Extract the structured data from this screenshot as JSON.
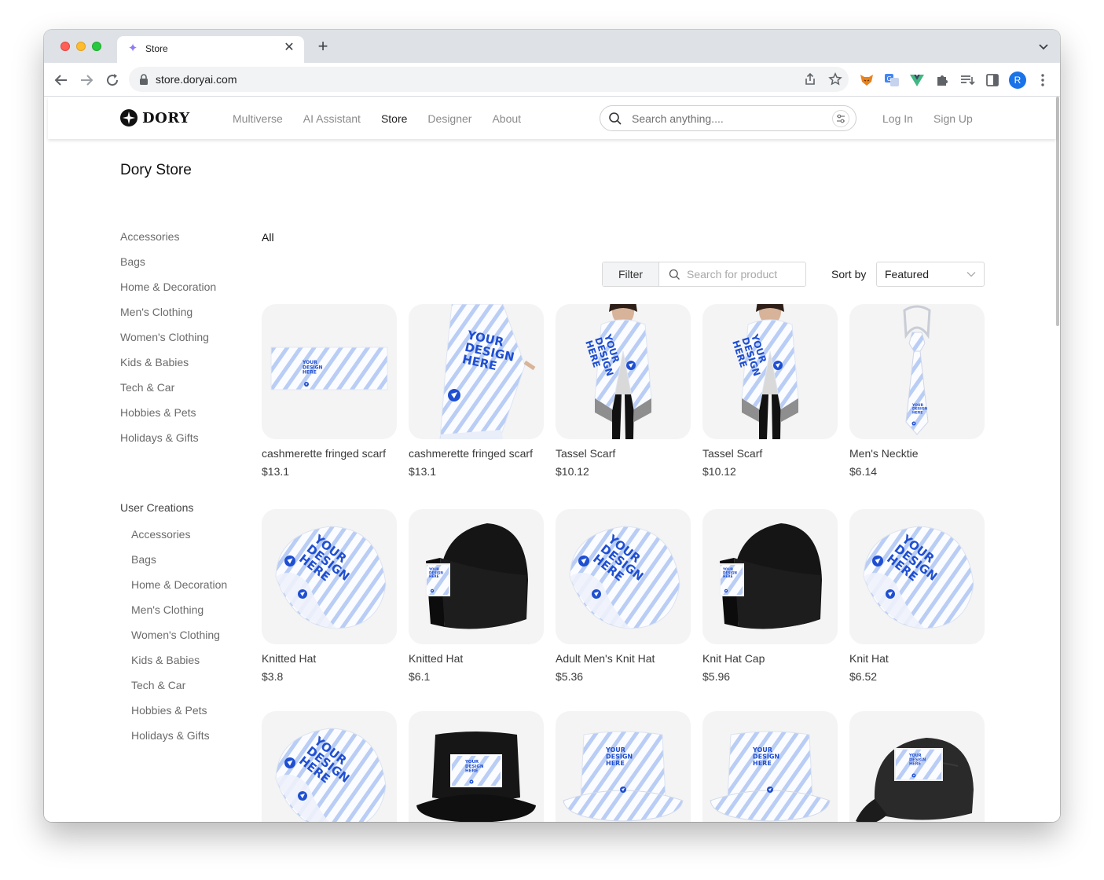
{
  "browser": {
    "tab_title": "Store",
    "url": "store.doryai.com",
    "profile_initial": "R"
  },
  "site": {
    "brand": "DORY",
    "nav": [
      "Multiverse",
      "AI Assistant",
      "Store",
      "Designer",
      "About"
    ],
    "nav_active": "Store",
    "search_placeholder": "Search anything....",
    "login_label": "Log In",
    "signup_label": "Sign Up"
  },
  "store": {
    "title": "Dory Store",
    "categories": [
      "Accessories",
      "Bags",
      "Home & Decoration",
      "Men's Clothing",
      "Women's Clothing",
      "Kids & Babies",
      "Tech & Car",
      "Hobbies & Pets",
      "Holidays & Gifts"
    ],
    "user_creations_label": "User Creations",
    "user_creations": [
      "Accessories",
      "Bags",
      "Home & Decoration",
      "Men's Clothing",
      "Women's Clothing",
      "Kids & Babies",
      "Tech & Car",
      "Hobbies & Pets",
      "Holidays & Gifts"
    ],
    "all_label": "All",
    "filter_label": "Filter",
    "product_search_placeholder": "Search for product",
    "sort_label": "Sort by",
    "sort_value": "Featured"
  },
  "products": [
    {
      "name": "cashmerette fringed scarf",
      "price": "$13.1",
      "kind": "scarf-flat"
    },
    {
      "name": "cashmerette fringed scarf",
      "price": "$13.1",
      "kind": "scarf-worn"
    },
    {
      "name": "Tassel Scarf",
      "price": "$10.12",
      "kind": "scarf-person"
    },
    {
      "name": "Tassel Scarf",
      "price": "$10.12",
      "kind": "scarf-person"
    },
    {
      "name": "Men's Necktie",
      "price": "$6.14",
      "kind": "necktie"
    },
    {
      "name": "Knitted Hat",
      "price": "$3.8",
      "kind": "beanie-white"
    },
    {
      "name": "Knitted Hat",
      "price": "$6.1",
      "kind": "beanie-black"
    },
    {
      "name": "Adult Men's Knit Hat",
      "price": "$5.36",
      "kind": "beanie-white"
    },
    {
      "name": "Knit Hat Cap",
      "price": "$5.96",
      "kind": "beanie-black"
    },
    {
      "name": "Knit Hat",
      "price": "$6.52",
      "kind": "beanie-white"
    },
    {
      "name": "",
      "price": "",
      "kind": "beanie-white"
    },
    {
      "name": "",
      "price": "",
      "kind": "bucket-black"
    },
    {
      "name": "",
      "price": "",
      "kind": "bucket-white"
    },
    {
      "name": "",
      "price": "",
      "kind": "bucket-white"
    },
    {
      "name": "",
      "price": "",
      "kind": "cap-black"
    }
  ],
  "icons": {
    "back": "arrow-left-icon",
    "forward": "arrow-right-icon",
    "reload": "reload-icon",
    "lock": "lock-icon",
    "share": "share-icon",
    "bookmark": "star-icon",
    "extensions": [
      "fox-extension-icon",
      "translate-extension-icon",
      "vue-extension-icon",
      "puzzle-icon",
      "reading-list-icon",
      "side-panel-icon"
    ]
  },
  "colors": {
    "accent_blue": "#1f4fd1",
    "pattern_blue": "#b9cdf5",
    "card_bg": "#f4f4f4"
  }
}
